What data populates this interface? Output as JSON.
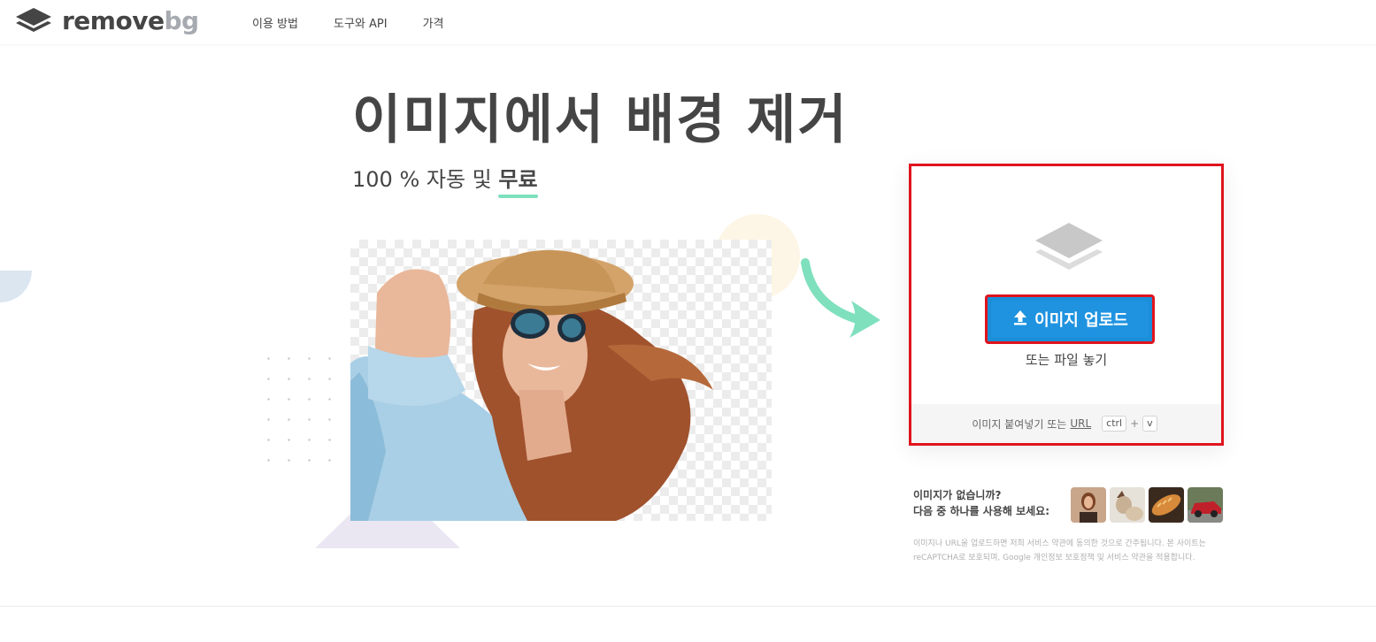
{
  "nav": {
    "logo_text_main": "remove",
    "logo_text_accent": "bg",
    "links": [
      {
        "label": "이용 방법"
      },
      {
        "label": "도구와 API"
      },
      {
        "label": "가격"
      }
    ]
  },
  "hero": {
    "title": "이미지에서 배경 제거",
    "subtitle_prefix": "100 % 자동 및 ",
    "subtitle_highlight": "무료"
  },
  "upload": {
    "button_label": "이미지 업로드",
    "drop_text": "또는 파일 놓기",
    "paste_text": "이미지 붙여넣기 또는",
    "paste_url": "URL",
    "key_ctrl": "ctrl",
    "key_plus": "+",
    "key_v": "v"
  },
  "samples": {
    "prompt_line1": "이미지가 없습니까?",
    "prompt_line2": "다음 중 하나를 사용해 보세요:",
    "items": [
      "sample-woman",
      "sample-cat",
      "sample-bread",
      "sample-car"
    ]
  },
  "disclaimer": "이미지나 URL을 업로드하면 저희 서비스 약관에 동의한 것으로 간주됩니다. 본 사이트는 reCAPTCHA로 보호되며, Google 개인정보 보호정책 및 서비스 약관을 적용합니다.",
  "colors": {
    "accent_blue": "#1f93e0",
    "highlight_red": "#e0141e",
    "underline_green": "#7fe0be",
    "text_dark": "#454545"
  }
}
